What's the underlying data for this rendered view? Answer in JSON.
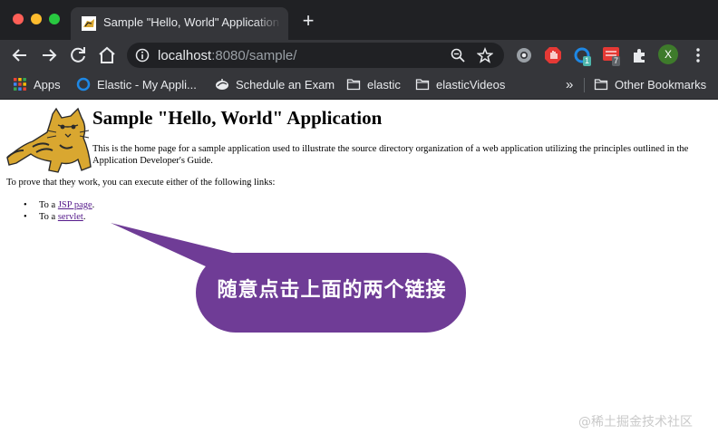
{
  "browser": {
    "tab_title": "Sample \"Hello, World\" Application",
    "new_tab_symbol": "+",
    "url_host": "localhost",
    "url_rest": ":8080/sample/",
    "avatar_letter": "X",
    "extension_badge_green": "1",
    "extension_badge_red": "7",
    "bookmarks": [
      {
        "label": "Apps",
        "icon": "apps-grid-icon"
      },
      {
        "label": "Elastic - My Appli...",
        "icon": "elastic-icon"
      },
      {
        "label": "Schedule an Exam",
        "icon": "exam-icon"
      },
      {
        "label": "elastic",
        "icon": "folder-icon"
      },
      {
        "label": "elasticVideos",
        "icon": "folder-icon"
      }
    ],
    "overflow_label": "»",
    "other_bookmarks": "Other Bookmarks"
  },
  "page": {
    "heading": "Sample \"Hello, World\" Application",
    "intro": "This is the home page for a sample application used to illustrate the source directory organization of a web application utilizing the principles outlined in the Application Developer's Guide.",
    "prove": "To prove that they work, you can execute either of the following links:",
    "links": [
      {
        "prefix": "To a ",
        "link": "JSP page",
        "suffix": "."
      },
      {
        "prefix": "To a ",
        "link": "servlet",
        "suffix": "."
      }
    ]
  },
  "annotation": {
    "text": "随意点击上面的两个链接",
    "color": "#6f3c96"
  },
  "watermark": "@稀土掘金技术社区"
}
